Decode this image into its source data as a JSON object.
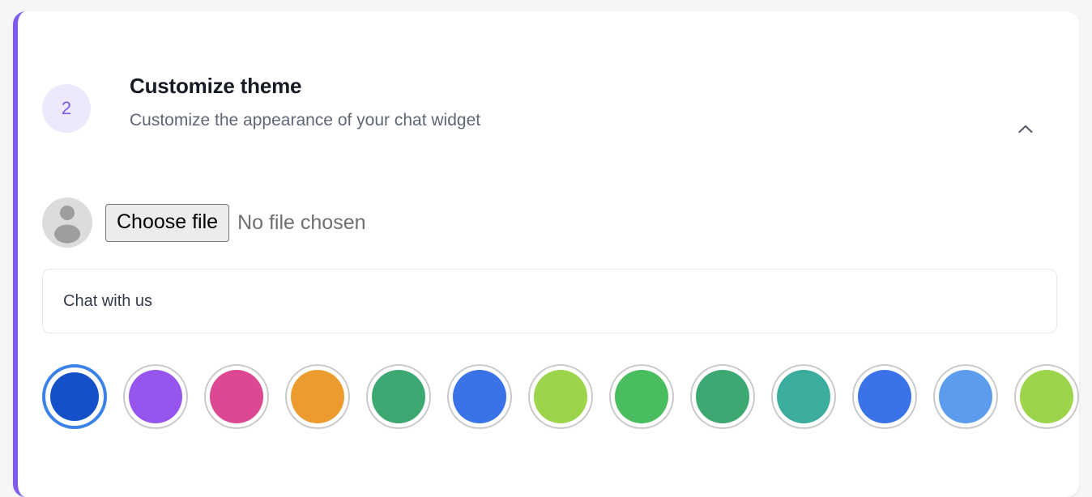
{
  "card": {
    "accent_color": "#7c5ce8",
    "step_number": "2",
    "title": "Customize theme",
    "subtitle": "Customize the appearance of your chat widget",
    "collapse_icon": "chevron-up-icon",
    "badge_bg": "#ede8fb",
    "badge_text_color": "#7c5ce8"
  },
  "logo_upload": {
    "avatar_icon": "user-avatar-placeholder-icon",
    "choose_file_label": "Choose file",
    "file_status": "No file chosen"
  },
  "widget_title_field": {
    "value": "Chat with us",
    "placeholder": "Chat with us"
  },
  "color_picker": {
    "selected_index": 0,
    "selected_ring_color": "#3b82e8",
    "swatches": [
      {
        "name": "blue",
        "hex": "#1450c8",
        "selected": true
      },
      {
        "name": "purple",
        "hex": "#7b5ce8",
        "selected": false
      },
      {
        "name": "violet",
        "hex": "#9655ec",
        "selected": false
      },
      {
        "name": "red",
        "hex": "#e04b3e",
        "selected": false
      },
      {
        "name": "pink",
        "hex": "#dc4892",
        "selected": false
      },
      {
        "name": "orange",
        "hex": "#e8742a",
        "selected": false
      },
      {
        "name": "amber",
        "hex": "#ec9c2f",
        "selected": false
      },
      {
        "name": "green",
        "hex": "#48bc5e",
        "selected": false
      },
      {
        "name": "sea-green",
        "hex": "#3ea873",
        "selected": false
      },
      {
        "name": "teal",
        "hex": "#3cac9c",
        "selected": false
      },
      {
        "name": "royal-blue",
        "hex": "#3a72e8",
        "selected": false
      },
      {
        "name": "light-blue",
        "hex": "#5c9cec",
        "selected": false
      },
      {
        "name": "lime",
        "hex": "#9cd44c",
        "selected": false
      },
      {
        "name": "yellow",
        "hex": "#f4c446",
        "selected": false
      }
    ]
  }
}
